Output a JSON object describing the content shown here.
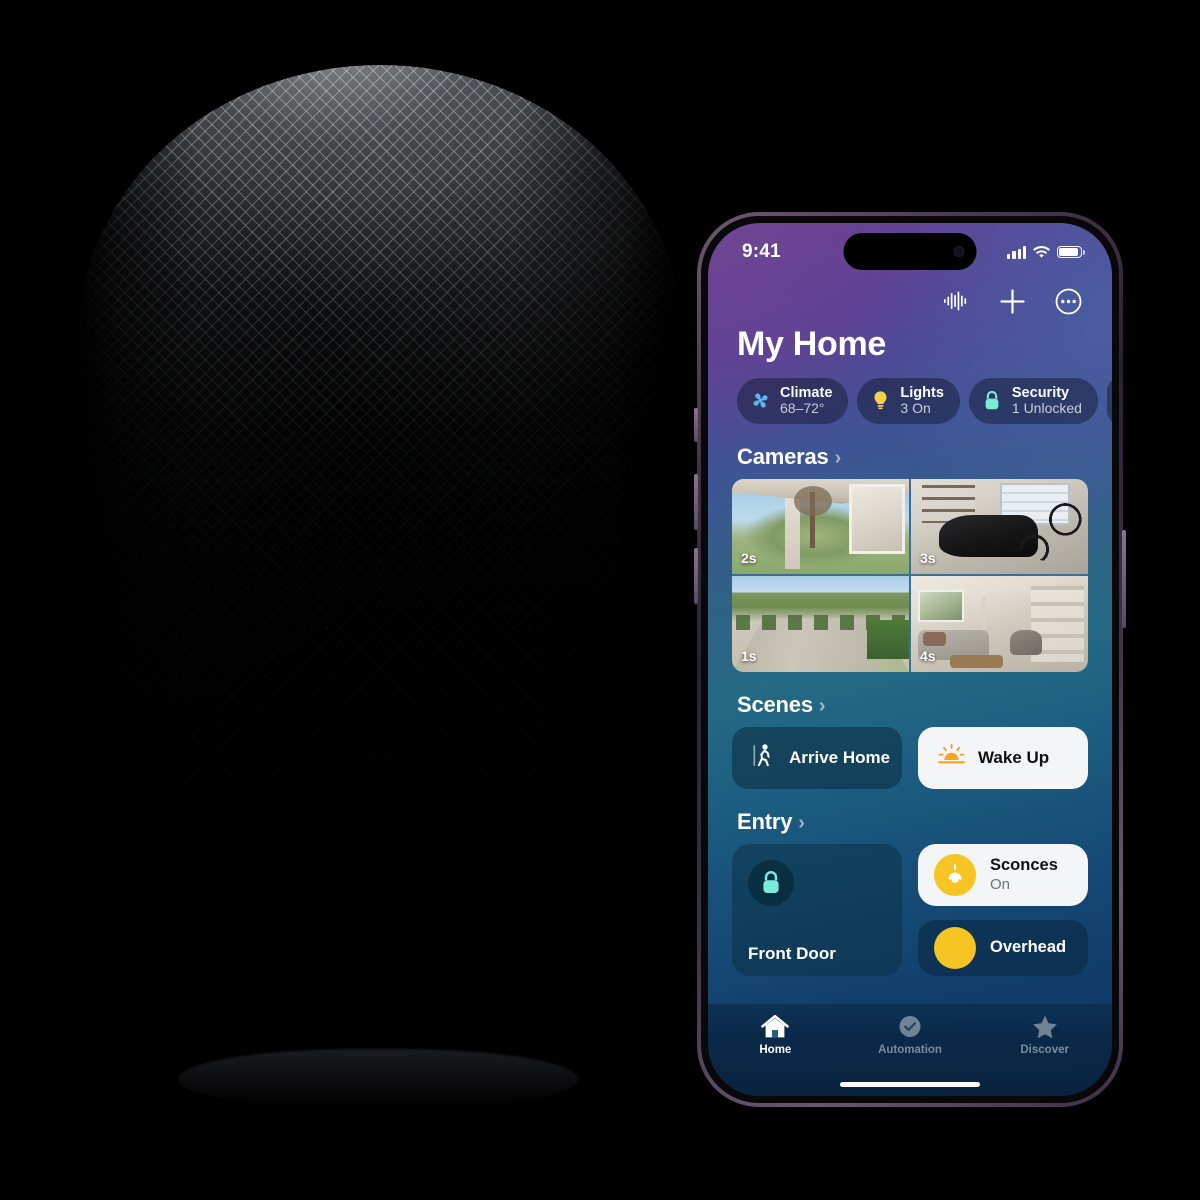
{
  "product": {
    "name": "HomePod",
    "finish": "Midnight"
  },
  "phone": {
    "status_bar": {
      "time": "9:41",
      "cellular": "signal-bars",
      "wifi": "wifi-icon",
      "battery": "battery-full-icon"
    },
    "header": {
      "title": "My Home",
      "actions": [
        {
          "name": "siri-waveform",
          "icon": "waveform-icon"
        },
        {
          "name": "add",
          "icon": "plus-icon"
        },
        {
          "name": "more",
          "icon": "ellipsis-circle-icon"
        }
      ]
    },
    "status_pills": [
      {
        "icon": "fan-icon",
        "name": "Climate",
        "value": "68–72°",
        "color": "#5ab6ea"
      },
      {
        "icon": "bulb-icon",
        "name": "Lights",
        "value": "3 On",
        "color": "#f7d046"
      },
      {
        "icon": "lock-icon",
        "name": "Security",
        "value": "1 Unlocked",
        "color": "#7ceada"
      },
      {
        "icon": "partial-pill",
        "name": "",
        "value": "",
        "color": "#7ceada"
      }
    ],
    "sections": {
      "cameras": {
        "title": "Cameras",
        "tiles": [
          {
            "name": "front-porch",
            "timestamp": "2s"
          },
          {
            "name": "garage",
            "timestamp": "3s"
          },
          {
            "name": "driveway",
            "timestamp": "1s"
          },
          {
            "name": "living-room",
            "timestamp": "4s"
          }
        ]
      },
      "scenes": {
        "title": "Scenes",
        "items": [
          {
            "label": "Arrive Home",
            "icon": "walking-person-icon",
            "style": "dark"
          },
          {
            "label": "Wake Up",
            "icon": "sunrise-icon",
            "style": "light"
          }
        ]
      },
      "entry": {
        "title": "Entry",
        "lock_tile": {
          "label": "Front Door",
          "icon": "lock-icon",
          "accent": "#7ceada"
        },
        "accessories": [
          {
            "label": "Sconces",
            "state": "On",
            "icon": "pendant-lamp-icon",
            "style": "light",
            "accent": "#f6c523"
          },
          {
            "label": "Overhead",
            "state": "",
            "icon": "bulb-icon",
            "style": "dark",
            "accent": "#f6c523"
          }
        ]
      }
    },
    "tab_bar": [
      {
        "label": "Home",
        "icon": "house-icon",
        "active": true
      },
      {
        "label": "Automation",
        "icon": "clock-icon",
        "active": false
      },
      {
        "label": "Discover",
        "icon": "star-icon",
        "active": false
      }
    ]
  }
}
